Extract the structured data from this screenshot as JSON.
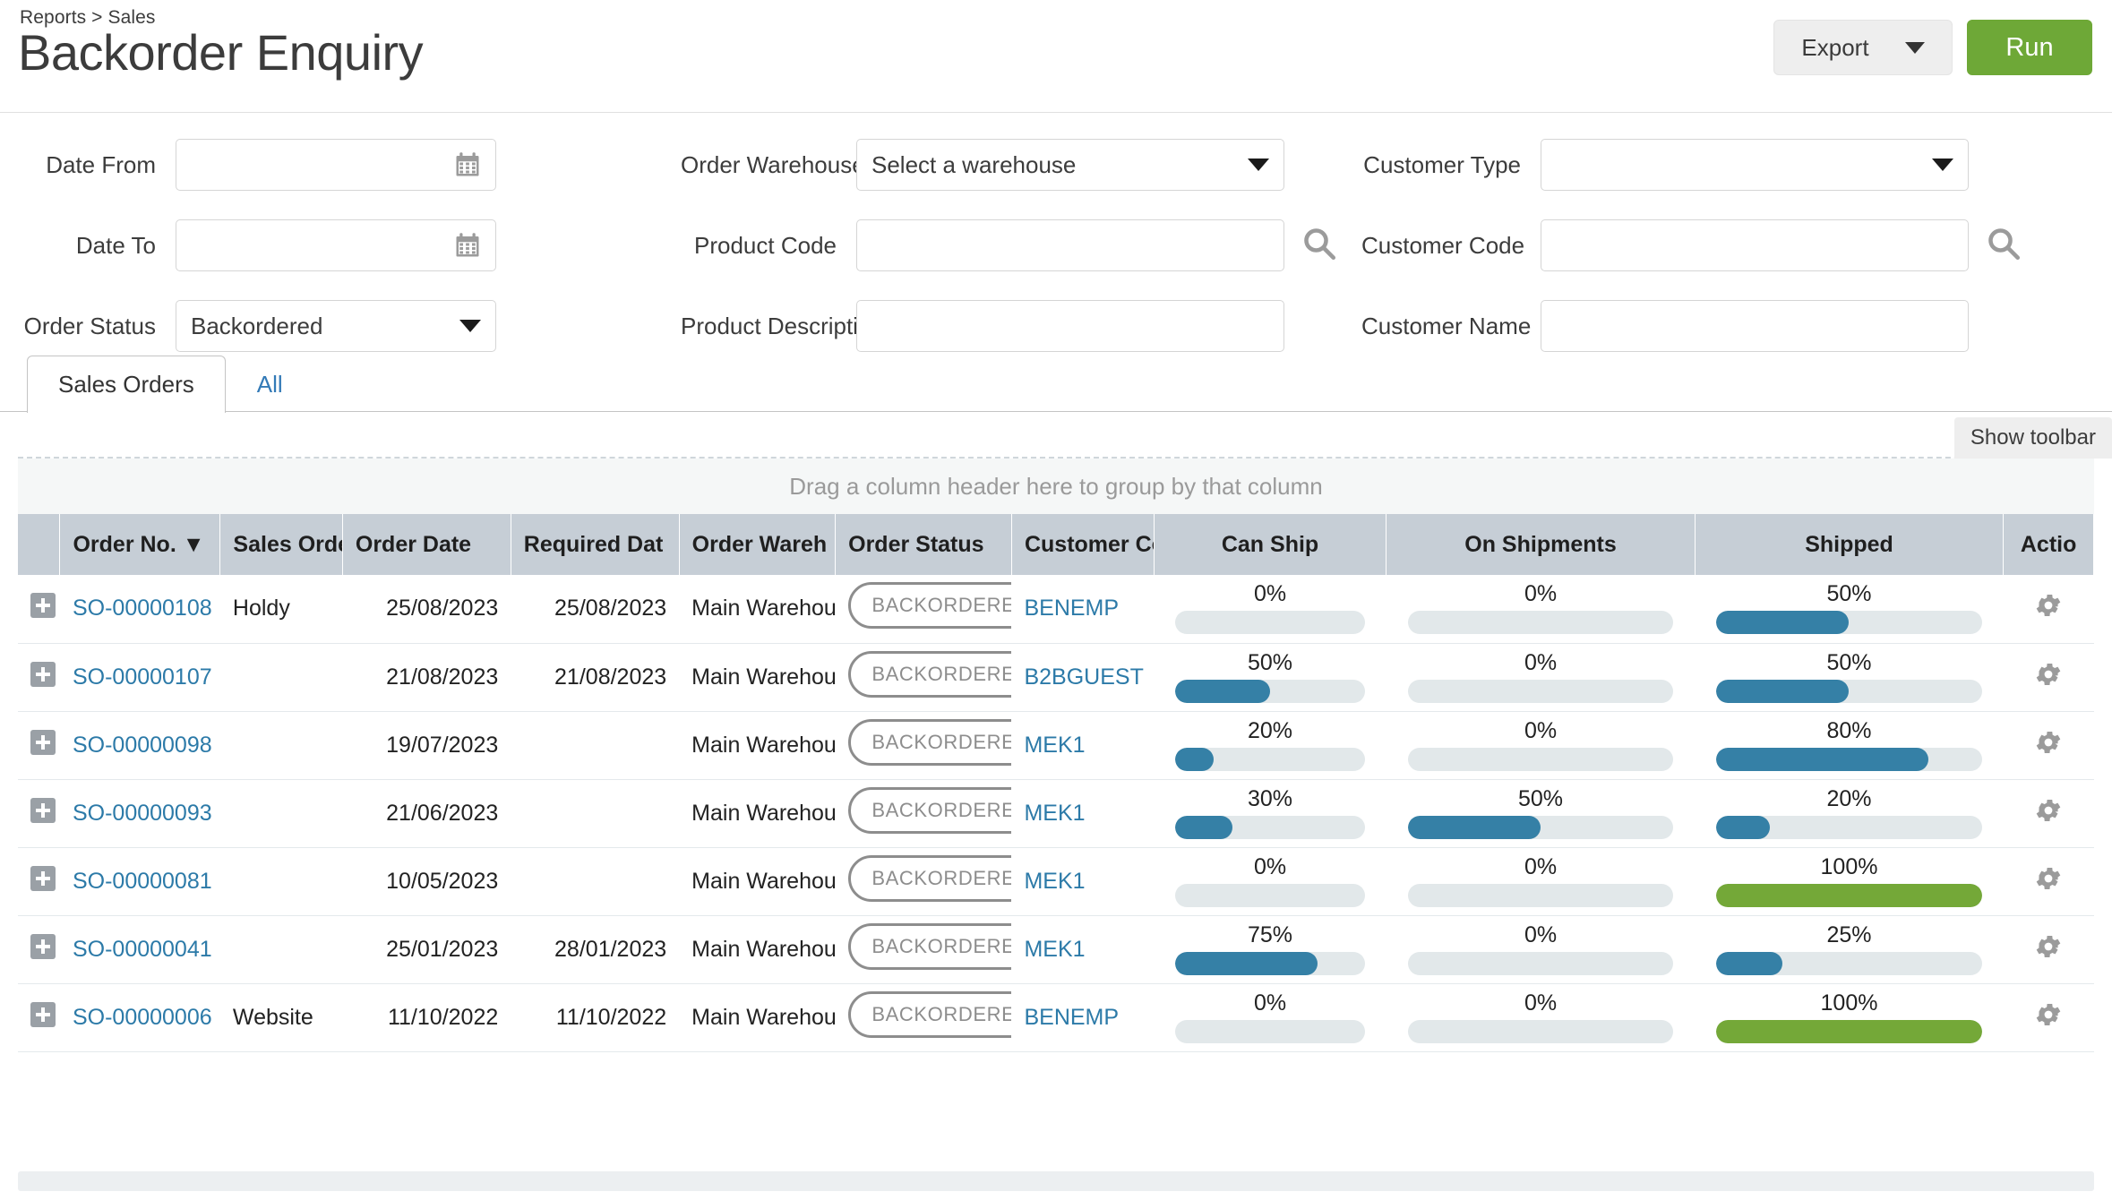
{
  "header": {
    "breadcrumb": "Reports > Sales",
    "title": "Backorder Enquiry",
    "export_label": "Export",
    "run_label": "Run"
  },
  "filters": {
    "col1": [
      {
        "label": "Date From",
        "value": "",
        "placeholder": "",
        "control": "date"
      },
      {
        "label": "Date To",
        "value": "",
        "placeholder": "",
        "control": "date"
      },
      {
        "label": "Order Status",
        "value": "Backordered",
        "control": "select"
      }
    ],
    "col2": [
      {
        "label": "Order Warehouse",
        "value": "Select a warehouse",
        "control": "select"
      },
      {
        "label": "Product Code",
        "value": "",
        "control": "search"
      },
      {
        "label": "Product Description",
        "value": "",
        "control": "text"
      }
    ],
    "col3": [
      {
        "label": "Customer Type",
        "value": "",
        "control": "select"
      },
      {
        "label": "Customer Code",
        "value": "",
        "control": "search"
      },
      {
        "label": "Customer Name",
        "value": "",
        "control": "text"
      }
    ]
  },
  "tabs": [
    {
      "label": "Sales Orders",
      "active": true
    },
    {
      "label": "All",
      "active": false
    }
  ],
  "toolbar": {
    "show_toolbar_label": "Show toolbar"
  },
  "grid": {
    "group_panel_text": "Drag a column header here to group by that column",
    "sort_column": "Order No.",
    "sort_indicator": "▼",
    "columns": [
      "Order No.",
      "Sales Order",
      "Order Date",
      "Required Dat",
      "Order Wareh",
      "Order Status",
      "Customer Co",
      "Can Ship",
      "On Shipments",
      "Shipped",
      "Actio"
    ],
    "rows": [
      {
        "order_no": "SO-00000108",
        "sales_order": "Holdy",
        "order_date": "25/08/2023",
        "required_date": "25/08/2023",
        "required_overdue": true,
        "warehouse": "Main Warehous",
        "status": "BACKORDERED",
        "customer_code": "BENEMP",
        "can_ship": 0,
        "on_shipments": 0,
        "shipped": 50
      },
      {
        "order_no": "SO-00000107",
        "sales_order": "",
        "order_date": "21/08/2023",
        "required_date": "21/08/2023",
        "required_overdue": true,
        "warehouse": "Main Warehous",
        "status": "BACKORDERED",
        "customer_code": "B2BGUEST",
        "can_ship": 50,
        "on_shipments": 0,
        "shipped": 50
      },
      {
        "order_no": "SO-00000098",
        "sales_order": "",
        "order_date": "19/07/2023",
        "required_date": "",
        "required_overdue": true,
        "warehouse": "Main Warehous",
        "status": "BACKORDERED",
        "customer_code": "MEK1",
        "can_ship": 20,
        "on_shipments": 0,
        "shipped": 80
      },
      {
        "order_no": "SO-00000093",
        "sales_order": "",
        "order_date": "21/06/2023",
        "required_date": "",
        "required_overdue": true,
        "warehouse": "Main Warehous",
        "status": "BACKORDERED",
        "customer_code": "MEK1",
        "can_ship": 30,
        "on_shipments": 50,
        "shipped": 20
      },
      {
        "order_no": "SO-00000081",
        "sales_order": "",
        "order_date": "10/05/2023",
        "required_date": "",
        "required_overdue": true,
        "warehouse": "Main Warehous",
        "status": "BACKORDERED",
        "customer_code": "MEK1",
        "can_ship": 0,
        "on_shipments": 0,
        "shipped": 100
      },
      {
        "order_no": "SO-00000041",
        "sales_order": "",
        "order_date": "25/01/2023",
        "required_date": "28/01/2023",
        "required_overdue": true,
        "warehouse": "Main Warehous",
        "status": "BACKORDERED",
        "customer_code": "MEK1",
        "can_ship": 75,
        "on_shipments": 0,
        "shipped": 25
      },
      {
        "order_no": "SO-00000006",
        "sales_order": "Website",
        "order_date": "11/10/2022",
        "required_date": "11/10/2022",
        "required_overdue": true,
        "warehouse": "Main Warehous",
        "status": "BACKORDERED",
        "customer_code": "BENEMP",
        "can_ship": 0,
        "on_shipments": 0,
        "shipped": 100
      }
    ]
  },
  "colors": {
    "accent_green": "#6ea837",
    "progress_blue": "#3580a6",
    "progress_green": "#74a838",
    "link_blue": "#2c7aa8",
    "overdue_red": "#e11010",
    "header_grey": "#c6ced6"
  }
}
